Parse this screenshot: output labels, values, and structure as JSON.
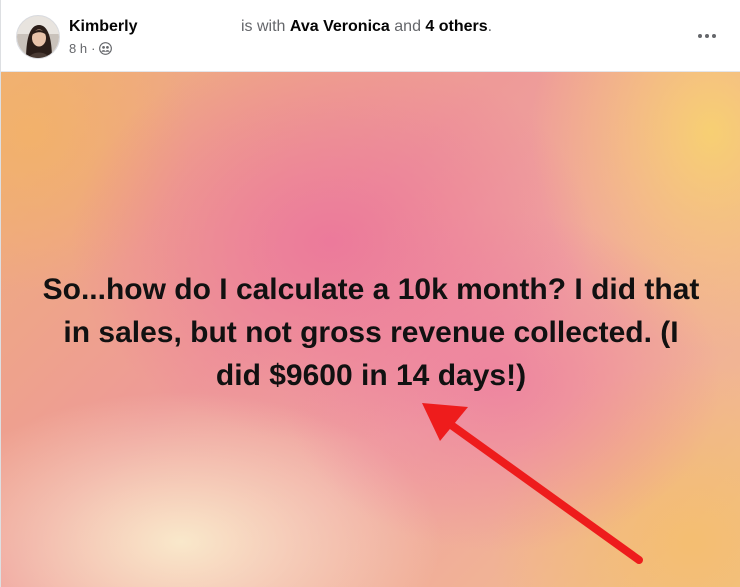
{
  "post": {
    "author": "Kimberly",
    "tag_prefix": "is with",
    "tagged_person": "Ava Veronica",
    "tag_conjunction": "and",
    "tagged_others": "4 others",
    "tag_suffix": ".",
    "time": "8 h",
    "separator": "·",
    "audience_icon": "friends-icon",
    "more_icon": "more-options-icon",
    "status_text": "So...how do I calculate a 10k month? I did that in sales, but not gross revenue collected. (I did $9600 in 14 days!)",
    "annotation_color": "#ee1c1c"
  }
}
